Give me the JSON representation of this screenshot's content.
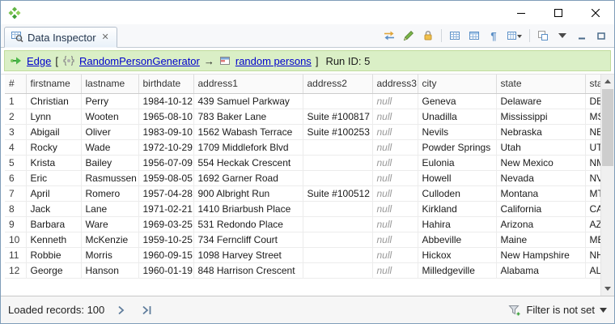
{
  "tab": {
    "label": "Data Inspector"
  },
  "icons": {
    "pilcrow": "¶",
    "tab_close": "✕"
  },
  "toolbar": {
    "buttons": [
      "sync",
      "edit",
      "lock",
      "grid-view",
      "table-view",
      "show-whitespace",
      "columns-menu",
      "open-new-window"
    ],
    "corner": [
      "view-menu",
      "minimize-view",
      "maximize-view"
    ]
  },
  "runbar": {
    "edge_link": "Edge",
    "open_bracket": "[",
    "component_link": "RandomPersonGenerator",
    "arrow": "→",
    "port_link": "random persons",
    "close_bracket": "]",
    "run_id": "Run ID: 5"
  },
  "table": {
    "headers": [
      "#",
      "firstname",
      "lastname",
      "birthdate",
      "address1",
      "address2",
      "address3",
      "city",
      "state",
      "stat"
    ],
    "null_text": "null",
    "rows": [
      {
        "num": 1,
        "cells": [
          "Christian",
          "Perry",
          "1984-10-12",
          "439 Samuel Parkway",
          "",
          null,
          "Geneva",
          "Delaware",
          "DE"
        ]
      },
      {
        "num": 2,
        "cells": [
          "Lynn",
          "Wooten",
          "1965-08-10",
          "783 Baker Lane",
          "Suite #100817",
          null,
          "Unadilla",
          "Mississippi",
          "MS"
        ]
      },
      {
        "num": 3,
        "cells": [
          "Abigail",
          "Oliver",
          "1983-09-10",
          "1562 Wabash Terrace",
          "Suite #100253",
          null,
          "Nevils",
          "Nebraska",
          "NE"
        ]
      },
      {
        "num": 4,
        "cells": [
          "Rocky",
          "Wade",
          "1972-10-29",
          "1709 Middlefork Blvd",
          "",
          null,
          "Powder Springs",
          "Utah",
          "UT"
        ]
      },
      {
        "num": 5,
        "cells": [
          "Krista",
          "Bailey",
          "1956-07-09",
          "554 Heckak Crescent",
          "",
          null,
          "Eulonia",
          "New Mexico",
          "NM"
        ]
      },
      {
        "num": 6,
        "cells": [
          "Eric",
          "Rasmussen",
          "1959-08-05",
          "1692 Garner Road",
          "",
          null,
          "Howell",
          "Nevada",
          "NV"
        ]
      },
      {
        "num": 7,
        "cells": [
          "April",
          "Romero",
          "1957-04-28",
          "900 Albright Run",
          "Suite #100512",
          null,
          "Culloden",
          "Montana",
          "MT"
        ]
      },
      {
        "num": 8,
        "cells": [
          "Jack",
          "Lane",
          "1971-02-21",
          "1410 Briarbush Place",
          "",
          null,
          "Kirkland",
          "California",
          "CA"
        ]
      },
      {
        "num": 9,
        "cells": [
          "Barbara",
          "Ware",
          "1969-03-25",
          "531 Redondo Place",
          "",
          null,
          "Hahira",
          "Arizona",
          "AZ"
        ]
      },
      {
        "num": 10,
        "cells": [
          "Kenneth",
          "McKenzie",
          "1959-10-25",
          "734 Ferncliff Court",
          "",
          null,
          "Abbeville",
          "Maine",
          "ME"
        ]
      },
      {
        "num": 11,
        "cells": [
          "Robbie",
          "Morris",
          "1960-09-15",
          "1098 Harvey Street",
          "",
          null,
          "Hickox",
          "New Hampshire",
          "NH"
        ]
      },
      {
        "num": 12,
        "cells": [
          "George",
          "Hanson",
          "1960-01-19",
          "848 Harrison Crescent",
          "",
          null,
          "Milledgeville",
          "Alabama",
          "AL"
        ]
      }
    ]
  },
  "statusbar": {
    "loaded_label": "Loaded records: 100",
    "filter_label": "Filter is not set"
  },
  "colors": {
    "runbar_bg": "#daefc6",
    "link": "#0000cc",
    "null_text": "#9a9a9a"
  }
}
